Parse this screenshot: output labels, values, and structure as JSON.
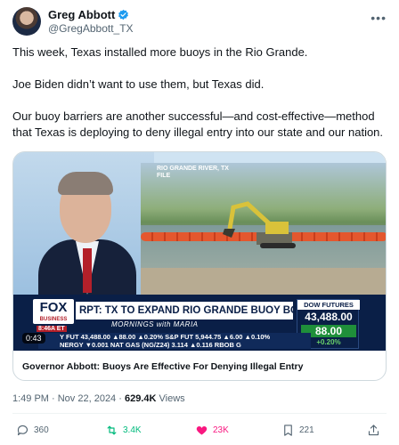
{
  "author": {
    "name": "Greg Abbott",
    "handle": "@GregAbbott_TX"
  },
  "tweet": {
    "paragraphs": [
      "This week, Texas installed more buoys in the Rio Grande.",
      "Joe Biden didn’t want to use them, but Texas did.",
      "Our buoy barriers are another successful—and cost-effective—method that Texas is deploying to deny illegal entry into our state and our nation."
    ]
  },
  "video": {
    "location_label_line1": "RIO GRANDE RIVER, TX",
    "location_label_line2": "FILE",
    "network": "FOX",
    "network_sub": "BUSINESS",
    "time": "8:46A ET",
    "headline": "RPT: TX TO EXPAND RIO GRANDE BUOY BORDER BARRIER",
    "show": "MORNINGS with MARIA",
    "dow_title": "DOW FUTURES",
    "dow_value": "43,488.00",
    "dow_change": "88.00",
    "dow_pct": "+0.20%",
    "ticker_line1": "Y FUT 43,488.00 ▲88.00 ▲0.20%  S&P FUT 5,944.75 ▲6.00 ▲0.10%",
    "ticker_line2": "NERGY ▼0.001  NAT GAS (NG/Z24) 3.114 ▲0.116  RBOB G",
    "duration": "0:43",
    "caption": "Governor Abbott: Buoys Are Effective For Denying Illegal Entry"
  },
  "meta": {
    "timestamp": "1:49 PM · Nov 22, 2024 · ",
    "views_count": "629.4K",
    "views_label": " Views"
  },
  "actions": {
    "replies": "360",
    "reposts": "3.4K",
    "likes": "23K",
    "bookmarks": "221"
  },
  "colors": {
    "repost_green": "#00ba7c",
    "like_pink": "#f91880",
    "verified_blue": "#1d9bf0",
    "fox_navy": "#0a1f47"
  }
}
